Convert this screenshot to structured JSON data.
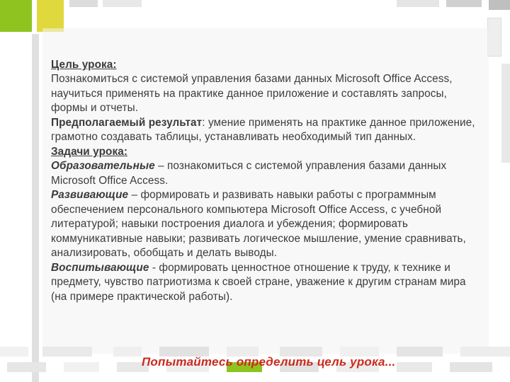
{
  "headings": {
    "goal": "Цель урока:",
    "tasks": "Задачи урока:"
  },
  "labels": {
    "expected_result": "Предполагаемый результат",
    "educational": "Образовательные",
    "developing": "Развивающие",
    "upbringing": "Воспитывающие"
  },
  "text": {
    "goal_body": "Познакомиться с системой управления базами данных Microsoft Office Access, научиться применять на практике данное приложение и  составлять запросы, формы и отчеты.",
    "expected_body": ": умение применять на практике данное приложение, грамотно создавать таблицы, устанавливать необходимый тип данных.",
    "educational_body": " – познакомиться с системой управления базами данных Microsoft Office Access.",
    "developing_body": " – формировать и развивать навыки работы с программным обеспечением персонального компьютера Microsoft Office Access, с учебной литературой; навыки построения диалога и убеждения; формировать коммуникативные навыки; развивать логическое мышление, умение сравнивать, анализировать, обобщать и делать выводы.",
    "upbringing_body": " - формировать ценностное отношение к труду, к технике и предмету, чувство патриотизма к своей стране, уважение к другим странам мира (на примере практической работы).",
    "prompt": "Попытайтесь определить цель урока..."
  },
  "colors": {
    "accent_green": "#8fc31f",
    "accent_yellow": "#dfd93e",
    "prompt_red": "#cc2a1d"
  }
}
